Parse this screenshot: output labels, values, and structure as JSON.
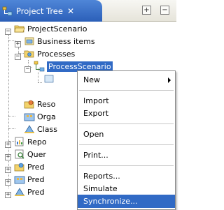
{
  "tab": {
    "title": "Project Tree",
    "close": "✕"
  },
  "window_buttons": {
    "maximize": "+",
    "minimize": "−"
  },
  "tree": {
    "root": "ProjectScenario",
    "business_items": "Business items",
    "processes": "Processes",
    "process_scenario": "ProcessScenario",
    "resources": "Reso",
    "organizations": "Orga",
    "classifiers": "Class",
    "reports": "Repo",
    "queries": "Quer",
    "predefined1": "Pred",
    "predefined2": "Pred",
    "predefined3": "Pred"
  },
  "menu": {
    "new": "New",
    "import": "Import",
    "export": "Export",
    "open": "Open",
    "print": "Print...",
    "reports": "Reports...",
    "simulate": "Simulate",
    "synchronize": "Synchronize..."
  },
  "colors": {
    "selection": "#316ac5",
    "tab": "#2b5fb8"
  }
}
